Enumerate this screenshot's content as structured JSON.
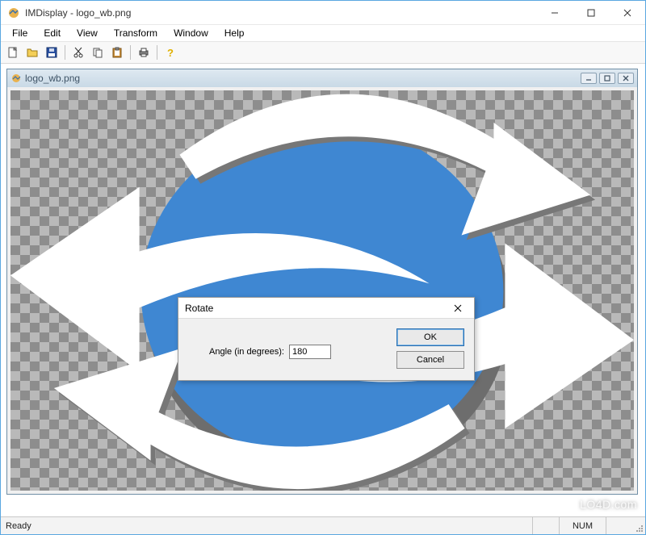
{
  "titlebar": {
    "title": "IMDisplay - logo_wb.png"
  },
  "menubar": {
    "items": [
      "File",
      "Edit",
      "View",
      "Transform",
      "Window",
      "Help"
    ]
  },
  "toolbar": {
    "icons": [
      "new",
      "open",
      "save",
      "cut",
      "copy",
      "paste",
      "print",
      "help"
    ]
  },
  "child_window": {
    "title": "logo_wb.png"
  },
  "dialog": {
    "title": "Rotate",
    "field_label": "Angle (in degrees):",
    "value": "180",
    "ok_label": "OK",
    "cancel_label": "Cancel"
  },
  "statusbar": {
    "ready": "Ready",
    "numlock": "NUM"
  },
  "watermark": {
    "text": "LO4D.com"
  },
  "colors": {
    "accent_blue": "#3f87d2",
    "window_border": "#5aa7e0",
    "toolbar_bg": "#f8f8f8"
  }
}
